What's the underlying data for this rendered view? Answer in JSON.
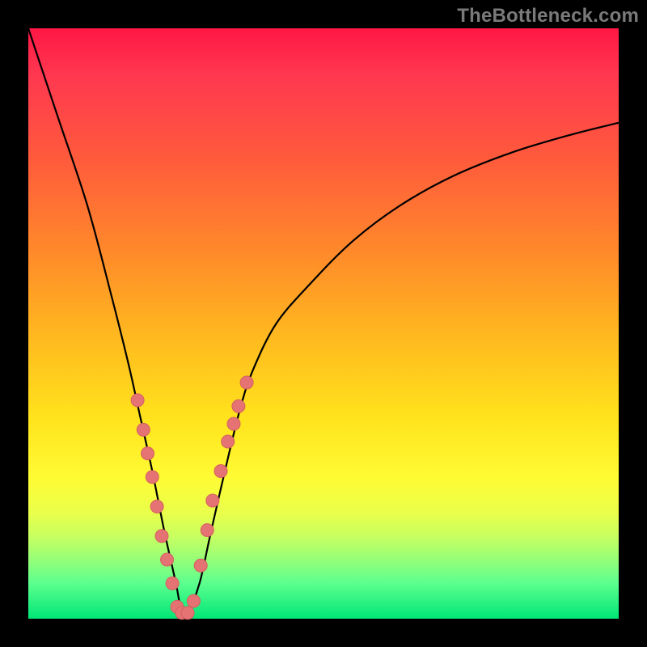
{
  "watermark": "TheBottleneck.com",
  "colors": {
    "curve": "#000000",
    "marker_fill": "#e57373",
    "marker_stroke": "#d4605f",
    "background_black": "#000000"
  },
  "chart_data": {
    "type": "line",
    "title": "",
    "xlabel": "",
    "ylabel": "",
    "xlim": [
      0,
      100
    ],
    "ylim": [
      0,
      100
    ],
    "series": [
      {
        "name": "bottleneck-curve",
        "x": [
          0,
          5,
          10,
          14,
          17,
          19,
          21,
          23,
          25,
          26,
          27,
          29,
          31,
          34,
          36,
          38,
          42,
          48,
          55,
          63,
          72,
          82,
          92,
          100
        ],
        "y": [
          100,
          85,
          70,
          55,
          43,
          34,
          25,
          15,
          6,
          1,
          1,
          6,
          15,
          28,
          36,
          42,
          50,
          57,
          64,
          70,
          75,
          79,
          82,
          84
        ]
      }
    ],
    "markers": {
      "name": "highlighted-points",
      "x": [
        18.5,
        19.5,
        20.2,
        21.0,
        21.8,
        22.6,
        23.5,
        24.4,
        25.2,
        26.0,
        27.0,
        28.0,
        29.2,
        30.3,
        31.2,
        32.6,
        33.8,
        34.8,
        35.6,
        37.0
      ],
      "y": [
        37,
        32,
        28,
        24,
        19,
        14,
        10,
        6,
        2,
        1,
        1,
        3,
        9,
        15,
        20,
        25,
        30,
        33,
        36,
        40
      ]
    }
  }
}
